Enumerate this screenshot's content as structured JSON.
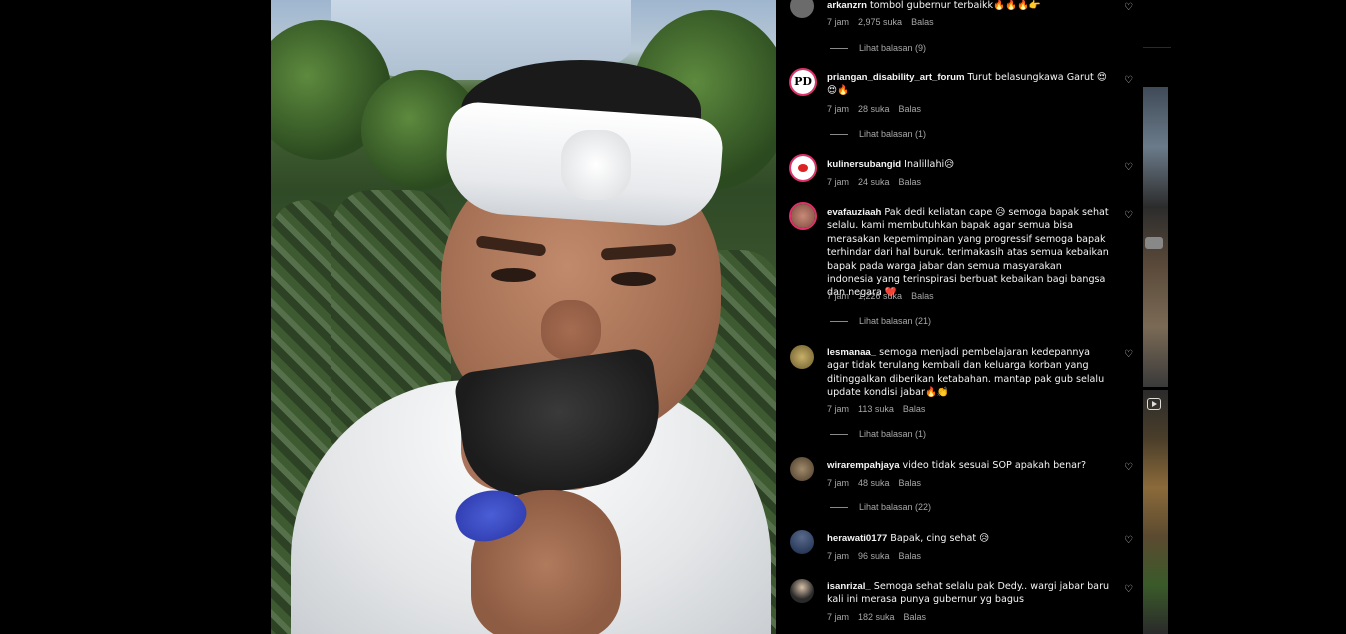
{
  "comments": [
    {
      "user": "arkanzrn",
      "text": "tombol gubernur terbaikk🔥🔥🔥👉",
      "time": "7 jam",
      "likes": "2,975 suka",
      "reply": "Balas",
      "view_replies": "Lihat balasan (9)",
      "avatar_color": "#6b6b6b"
    },
    {
      "user": "priangan_disability_art_forum",
      "text": "Turut belasungkawa Garut 😍😍🔥",
      "time": "7 jam",
      "likes": "28 suka",
      "reply": "Balas",
      "view_replies": "Lihat balasan (1)",
      "avatar_color": "#ffffff"
    },
    {
      "user": "kulinersubangid",
      "text": "Inalillahi😥",
      "time": "7 jam",
      "likes": "24 suka",
      "reply": "Balas",
      "view_replies": "",
      "avatar_color": "#ffffff"
    },
    {
      "user": "evafauziaah",
      "text": "Pak dedi keliatan cape 😥 semoga bapak sehat selalu. kami membutuhkan bapak agar semua bisa merasakan kepemimpinan yang progressif semoga bapak terhindar dari hal buruk. terimakasih atas semua kebaikan bapak pada warga jabar dan semua masyarakan indonesia yang terinspirasi berbuat kebaikan bagi bangsa dan negara ❤️",
      "time": "7 jam",
      "likes": "1,226 suka",
      "reply": "Balas",
      "view_replies": "Lihat balasan (21)",
      "avatar_color": "#8b5a4a"
    },
    {
      "user": "lesmanaa_",
      "text": "semoga menjadi pembelajaran kedepannya agar tidak terulang kembali dan keluarga korban yang ditinggalkan diberikan ketabahan. mantap pak gub selalu update kondisi jabar🔥👏",
      "time": "7 jam",
      "likes": "113 suka",
      "reply": "Balas",
      "view_replies": "Lihat balasan (1)",
      "avatar_color": "#9a8a5a"
    },
    {
      "user": "wirarempahjaya",
      "text": "video tidak sesuai SOP apakah benar?",
      "time": "7 jam",
      "likes": "48 suka",
      "reply": "Balas",
      "view_replies": "Lihat balasan (22)",
      "avatar_color": "#6a5a4a"
    },
    {
      "user": "herawati0177",
      "text": "Bapak, cing sehat 😥",
      "time": "7 jam",
      "likes": "96 suka",
      "reply": "Balas",
      "view_replies": "",
      "avatar_color": "#2a3a5a"
    },
    {
      "user": "isanrizal_",
      "text": "Semoga sehat selalu pak Dedy.. wargi jabar baru kali ini merasa punya gubernur yg bagus",
      "time": "7 jam",
      "likes": "182 suka",
      "reply": "Balas",
      "view_replies": "",
      "avatar_color": "#3a3a3a"
    }
  ],
  "icons": {
    "like": "heart-outline-icon",
    "reel": "reel-icon"
  }
}
